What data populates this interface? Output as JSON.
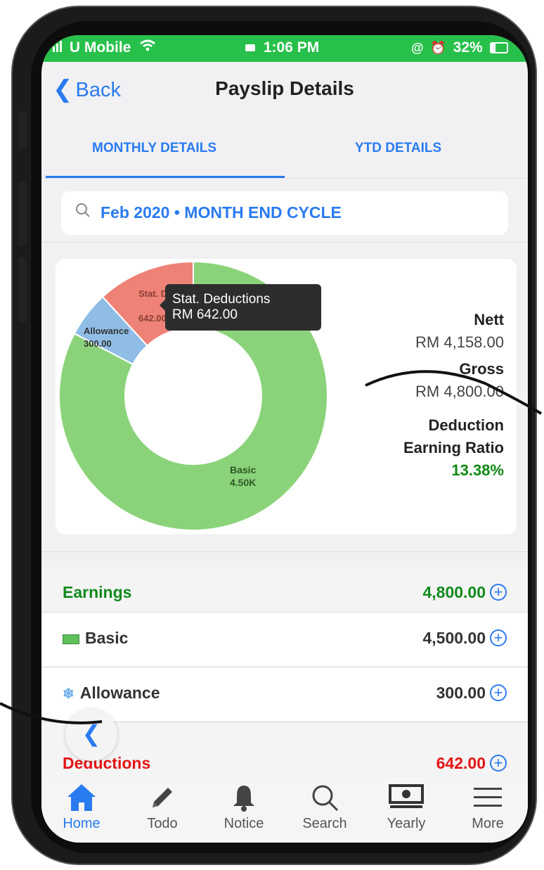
{
  "status_bar": {
    "carrier": "U Mobile",
    "time": "1:06 PM",
    "battery": "32%"
  },
  "nav": {
    "back_label": "Back",
    "title": "Payslip Details"
  },
  "tabs": [
    {
      "label": "MONTHLY DETAILS",
      "active": true
    },
    {
      "label": "YTD DETAILS",
      "active": false
    }
  ],
  "search": {
    "value": "Feb 2020 • MONTH END CYCLE"
  },
  "chart_data": {
    "type": "pie",
    "donut": true,
    "slices": [
      {
        "name": "Basic",
        "value": 4500,
        "label": "4.50K",
        "color": "#8bd37a"
      },
      {
        "name": "Allowance",
        "value": 300,
        "label": "300.00",
        "color": "#8fbde6"
      },
      {
        "name": "Stat. Deductions",
        "short_name": "Stat. Deduc",
        "value": 642,
        "label": "642.00",
        "color": "#ee8277"
      }
    ],
    "tooltip": {
      "title": "Stat. Deductions",
      "value": "RM 642.00"
    }
  },
  "summary": {
    "nett_label": "Nett",
    "nett_value": "RM 4,158.00",
    "gross_label": "Gross",
    "gross_value": "RM 4,800.00",
    "ratio_label_1": "Deduction",
    "ratio_label_2": "Earning Ratio",
    "ratio_value": "13.38%"
  },
  "rows": {
    "earnings": {
      "label": "Earnings",
      "amount": "4,800.00"
    },
    "basic": {
      "label": "Basic",
      "amount": "4,500.00"
    },
    "allowance": {
      "label": "Allowance",
      "amount": "300.00"
    },
    "deductions": {
      "label": "Deductions",
      "amount": "642.00"
    }
  },
  "tabbar": [
    {
      "label": "Home",
      "icon": "home-icon"
    },
    {
      "label": "Todo",
      "icon": "pencil-icon"
    },
    {
      "label": "Notice",
      "icon": "bell-icon"
    },
    {
      "label": "Search",
      "icon": "search-icon"
    },
    {
      "label": "Yearly",
      "icon": "money-icon"
    },
    {
      "label": "More",
      "icon": "menu-icon"
    }
  ],
  "colors": {
    "accent": "#2a7bf0",
    "status_bar": "#27c04a",
    "earnings": "#118a1c",
    "deductions": "#e51414",
    "ratio": "#0f8a14"
  }
}
